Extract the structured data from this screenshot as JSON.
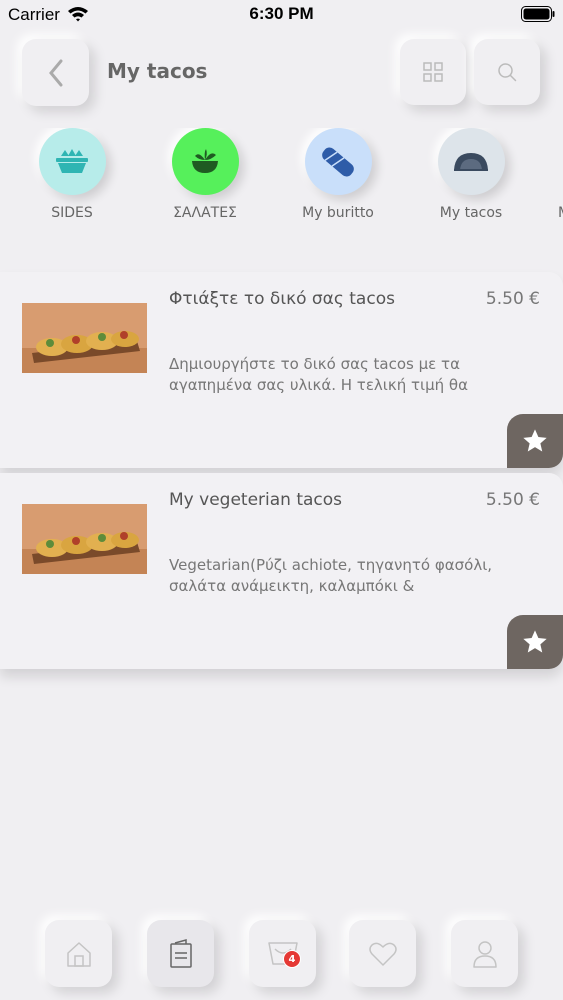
{
  "status_bar": {
    "carrier": "Carrier",
    "time": "6:30 PM"
  },
  "header": {
    "title": "My tacos",
    "back_icon": "chevron-left-icon",
    "grid_icon": "grid-icon",
    "search_icon": "search-icon"
  },
  "categories": [
    {
      "label": "SIDES",
      "icon": "nachos-bowl-icon",
      "color": "#b7ecea"
    },
    {
      "label": "ΣΑΛΑΤΕΣ",
      "icon": "salad-bowl-icon",
      "color": "#56f05b"
    },
    {
      "label": "My buritto",
      "icon": "burrito-icon",
      "color": "#c9dffa"
    },
    {
      "label": "My tacos",
      "icon": "taco-icon",
      "color": "#dde4ea"
    },
    {
      "label": "M",
      "icon": "",
      "color": "#f0eff2"
    }
  ],
  "products": [
    {
      "title": "Φτιάξτε το δικό σας tacos",
      "price": "5.50 €",
      "description": "Δημιουργήστε το δικό σας tacos με τα αγαπημένα σας υλικά. Η τελική τιμή θα",
      "fav_icon": "star-icon"
    },
    {
      "title": "My vegeterian tacos",
      "price": "5.50 €",
      "description": "Vegetarian(Ρύζι achiote, τηγανητό φασόλι, σαλάτα ανάμεικτη, καλαμπόκι &",
      "fav_icon": "star-icon"
    }
  ],
  "bottom_nav": {
    "items": [
      {
        "icon": "home-icon"
      },
      {
        "icon": "menu-icon",
        "active": true
      },
      {
        "icon": "cart-icon",
        "badge": "4"
      },
      {
        "icon": "heart-icon"
      },
      {
        "icon": "profile-icon"
      }
    ]
  },
  "colors": {
    "background": "#f0eff2",
    "accent_dark": "#6e6661",
    "badge": "#e53935"
  }
}
